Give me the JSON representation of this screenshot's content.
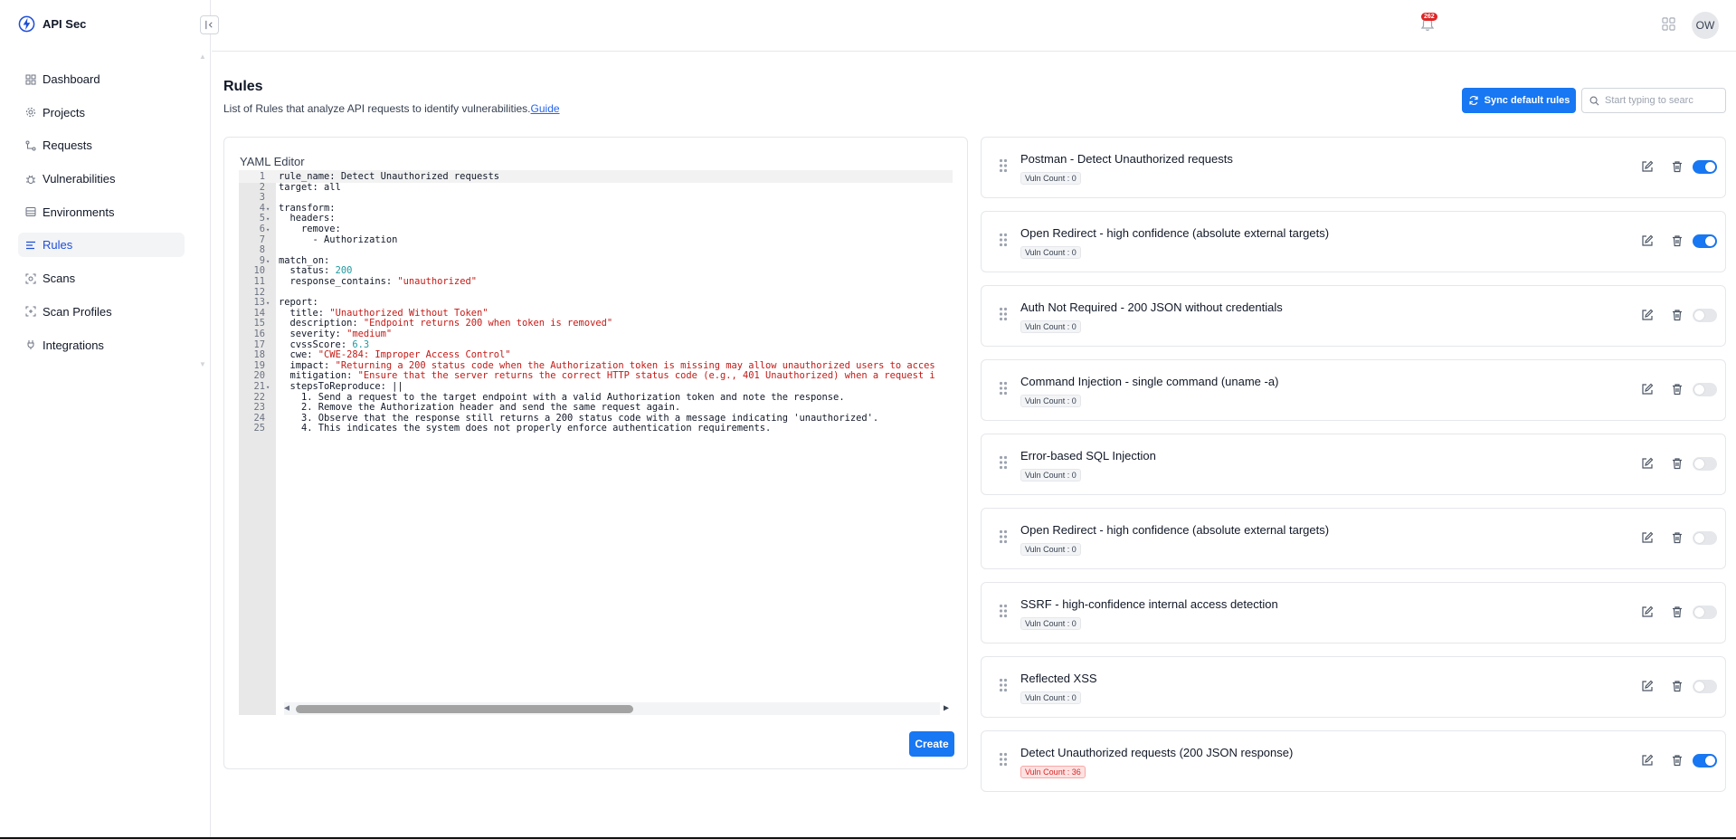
{
  "app": {
    "name": "API Sec"
  },
  "sidebar": {
    "items": [
      {
        "label": "Dashboard",
        "icon": "dashboard-icon",
        "active": false
      },
      {
        "label": "Projects",
        "icon": "gear-icon",
        "active": false
      },
      {
        "label": "Requests",
        "icon": "route-icon",
        "active": false
      },
      {
        "label": "Vulnerabilities",
        "icon": "bug-icon",
        "active": false
      },
      {
        "label": "Environments",
        "icon": "environment-icon",
        "active": false
      },
      {
        "label": "Rules",
        "icon": "rules-icon",
        "active": true
      },
      {
        "label": "Scans",
        "icon": "scan-icon",
        "active": false
      },
      {
        "label": "Scan Profiles",
        "icon": "scan-profile-icon",
        "active": false
      },
      {
        "label": "Integrations",
        "icon": "plug-icon",
        "active": false
      }
    ]
  },
  "topbar": {
    "notification_count": "262",
    "avatar_initials": "OW"
  },
  "header": {
    "title": "Rules",
    "description": "List of Rules that analyze API requests to identify vulnerabilities.",
    "guide_link": "Guide",
    "sync_button": "Sync default rules",
    "search_placeholder": "Start typing to searc"
  },
  "editor": {
    "label": "YAML Editor",
    "create_button": "Create",
    "lines": [
      "rule_name: Detect Unauthorized requests",
      "target: all",
      "",
      "transform:",
      "  headers:",
      "    remove:",
      "      - Authorization",
      "",
      "match_on:",
      "  status: 200",
      "  response_contains: \"unauthorized\"",
      "",
      "report:",
      "  title: \"Unauthorized Without Token\"",
      "  description: \"Endpoint returns 200 when token is removed\"",
      "  severity: \"medium\"",
      "  cvssScore: 6.3",
      "  cwe: \"CWE-284: Improper Access Control\"",
      "  impact: \"Returning a 200 status code when the Authorization token is missing may allow unauthorized users to acces",
      "  mitigation: \"Ensure that the server returns the correct HTTP status code (e.g., 401 Unauthorized) when a request i",
      "  stepsToReproduce: |",
      "    1. Send a request to the target endpoint with a valid Authorization token and note the response.",
      "    2. Remove the Authorization header and send the same request again.",
      "    3. Observe that the response still returns a 200 status code with a message indicating 'unauthorized'.",
      "    4. This indicates the system does not properly enforce authentication requirements."
    ]
  },
  "rules": [
    {
      "title": "Postman - Detect Unauthorized requests",
      "vuln_count": "Vuln Count : 0",
      "enabled": true,
      "highlight": false
    },
    {
      "title": "Open Redirect - high confidence (absolute external targets)",
      "vuln_count": "Vuln Count : 0",
      "enabled": true,
      "highlight": false
    },
    {
      "title": "Auth Not Required - 200 JSON without credentials",
      "vuln_count": "Vuln Count : 0",
      "enabled": false,
      "highlight": false
    },
    {
      "title": "Command Injection - single command (uname -a)",
      "vuln_count": "Vuln Count : 0",
      "enabled": false,
      "highlight": false
    },
    {
      "title": "Error-based SQL Injection",
      "vuln_count": "Vuln Count : 0",
      "enabled": false,
      "highlight": false
    },
    {
      "title": "Open Redirect - high confidence (absolute external targets)",
      "vuln_count": "Vuln Count : 0",
      "enabled": false,
      "highlight": false
    },
    {
      "title": "SSRF - high-confidence internal access detection",
      "vuln_count": "Vuln Count : 0",
      "enabled": false,
      "highlight": false
    },
    {
      "title": "Reflected XSS",
      "vuln_count": "Vuln Count : 0",
      "enabled": false,
      "highlight": false
    },
    {
      "title": "Detect Unauthorized requests (200 JSON response)",
      "vuln_count": "Vuln Count : 36",
      "enabled": true,
      "highlight": true
    }
  ],
  "colors": {
    "accent": "#1877f2",
    "danger": "#dc2626"
  }
}
